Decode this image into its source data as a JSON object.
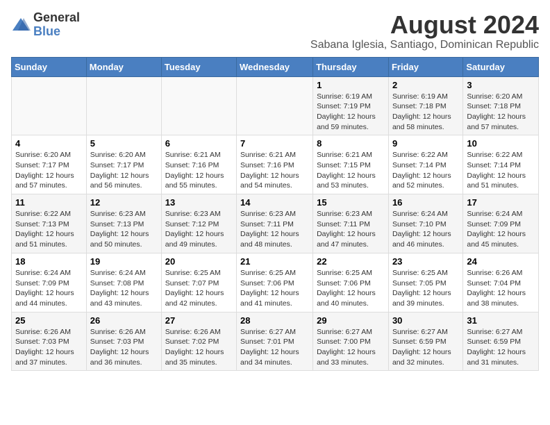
{
  "header": {
    "logo_general": "General",
    "logo_blue": "Blue",
    "month_year": "August 2024",
    "location": "Sabana Iglesia, Santiago, Dominican Republic"
  },
  "days_of_week": [
    "Sunday",
    "Monday",
    "Tuesday",
    "Wednesday",
    "Thursday",
    "Friday",
    "Saturday"
  ],
  "weeks": [
    [
      {
        "day": "",
        "info": ""
      },
      {
        "day": "",
        "info": ""
      },
      {
        "day": "",
        "info": ""
      },
      {
        "day": "",
        "info": ""
      },
      {
        "day": "1",
        "info": "Sunrise: 6:19 AM\nSunset: 7:19 PM\nDaylight: 12 hours\nand 59 minutes."
      },
      {
        "day": "2",
        "info": "Sunrise: 6:19 AM\nSunset: 7:18 PM\nDaylight: 12 hours\nand 58 minutes."
      },
      {
        "day": "3",
        "info": "Sunrise: 6:20 AM\nSunset: 7:18 PM\nDaylight: 12 hours\nand 57 minutes."
      }
    ],
    [
      {
        "day": "4",
        "info": "Sunrise: 6:20 AM\nSunset: 7:17 PM\nDaylight: 12 hours\nand 57 minutes."
      },
      {
        "day": "5",
        "info": "Sunrise: 6:20 AM\nSunset: 7:17 PM\nDaylight: 12 hours\nand 56 minutes."
      },
      {
        "day": "6",
        "info": "Sunrise: 6:21 AM\nSunset: 7:16 PM\nDaylight: 12 hours\nand 55 minutes."
      },
      {
        "day": "7",
        "info": "Sunrise: 6:21 AM\nSunset: 7:16 PM\nDaylight: 12 hours\nand 54 minutes."
      },
      {
        "day": "8",
        "info": "Sunrise: 6:21 AM\nSunset: 7:15 PM\nDaylight: 12 hours\nand 53 minutes."
      },
      {
        "day": "9",
        "info": "Sunrise: 6:22 AM\nSunset: 7:14 PM\nDaylight: 12 hours\nand 52 minutes."
      },
      {
        "day": "10",
        "info": "Sunrise: 6:22 AM\nSunset: 7:14 PM\nDaylight: 12 hours\nand 51 minutes."
      }
    ],
    [
      {
        "day": "11",
        "info": "Sunrise: 6:22 AM\nSunset: 7:13 PM\nDaylight: 12 hours\nand 51 minutes."
      },
      {
        "day": "12",
        "info": "Sunrise: 6:23 AM\nSunset: 7:13 PM\nDaylight: 12 hours\nand 50 minutes."
      },
      {
        "day": "13",
        "info": "Sunrise: 6:23 AM\nSunset: 7:12 PM\nDaylight: 12 hours\nand 49 minutes."
      },
      {
        "day": "14",
        "info": "Sunrise: 6:23 AM\nSunset: 7:11 PM\nDaylight: 12 hours\nand 48 minutes."
      },
      {
        "day": "15",
        "info": "Sunrise: 6:23 AM\nSunset: 7:11 PM\nDaylight: 12 hours\nand 47 minutes."
      },
      {
        "day": "16",
        "info": "Sunrise: 6:24 AM\nSunset: 7:10 PM\nDaylight: 12 hours\nand 46 minutes."
      },
      {
        "day": "17",
        "info": "Sunrise: 6:24 AM\nSunset: 7:09 PM\nDaylight: 12 hours\nand 45 minutes."
      }
    ],
    [
      {
        "day": "18",
        "info": "Sunrise: 6:24 AM\nSunset: 7:09 PM\nDaylight: 12 hours\nand 44 minutes."
      },
      {
        "day": "19",
        "info": "Sunrise: 6:24 AM\nSunset: 7:08 PM\nDaylight: 12 hours\nand 43 minutes."
      },
      {
        "day": "20",
        "info": "Sunrise: 6:25 AM\nSunset: 7:07 PM\nDaylight: 12 hours\nand 42 minutes."
      },
      {
        "day": "21",
        "info": "Sunrise: 6:25 AM\nSunset: 7:06 PM\nDaylight: 12 hours\nand 41 minutes."
      },
      {
        "day": "22",
        "info": "Sunrise: 6:25 AM\nSunset: 7:06 PM\nDaylight: 12 hours\nand 40 minutes."
      },
      {
        "day": "23",
        "info": "Sunrise: 6:25 AM\nSunset: 7:05 PM\nDaylight: 12 hours\nand 39 minutes."
      },
      {
        "day": "24",
        "info": "Sunrise: 6:26 AM\nSunset: 7:04 PM\nDaylight: 12 hours\nand 38 minutes."
      }
    ],
    [
      {
        "day": "25",
        "info": "Sunrise: 6:26 AM\nSunset: 7:03 PM\nDaylight: 12 hours\nand 37 minutes."
      },
      {
        "day": "26",
        "info": "Sunrise: 6:26 AM\nSunset: 7:03 PM\nDaylight: 12 hours\nand 36 minutes."
      },
      {
        "day": "27",
        "info": "Sunrise: 6:26 AM\nSunset: 7:02 PM\nDaylight: 12 hours\nand 35 minutes."
      },
      {
        "day": "28",
        "info": "Sunrise: 6:27 AM\nSunset: 7:01 PM\nDaylight: 12 hours\nand 34 minutes."
      },
      {
        "day": "29",
        "info": "Sunrise: 6:27 AM\nSunset: 7:00 PM\nDaylight: 12 hours\nand 33 minutes."
      },
      {
        "day": "30",
        "info": "Sunrise: 6:27 AM\nSunset: 6:59 PM\nDaylight: 12 hours\nand 32 minutes."
      },
      {
        "day": "31",
        "info": "Sunrise: 6:27 AM\nSunset: 6:59 PM\nDaylight: 12 hours\nand 31 minutes."
      }
    ]
  ]
}
